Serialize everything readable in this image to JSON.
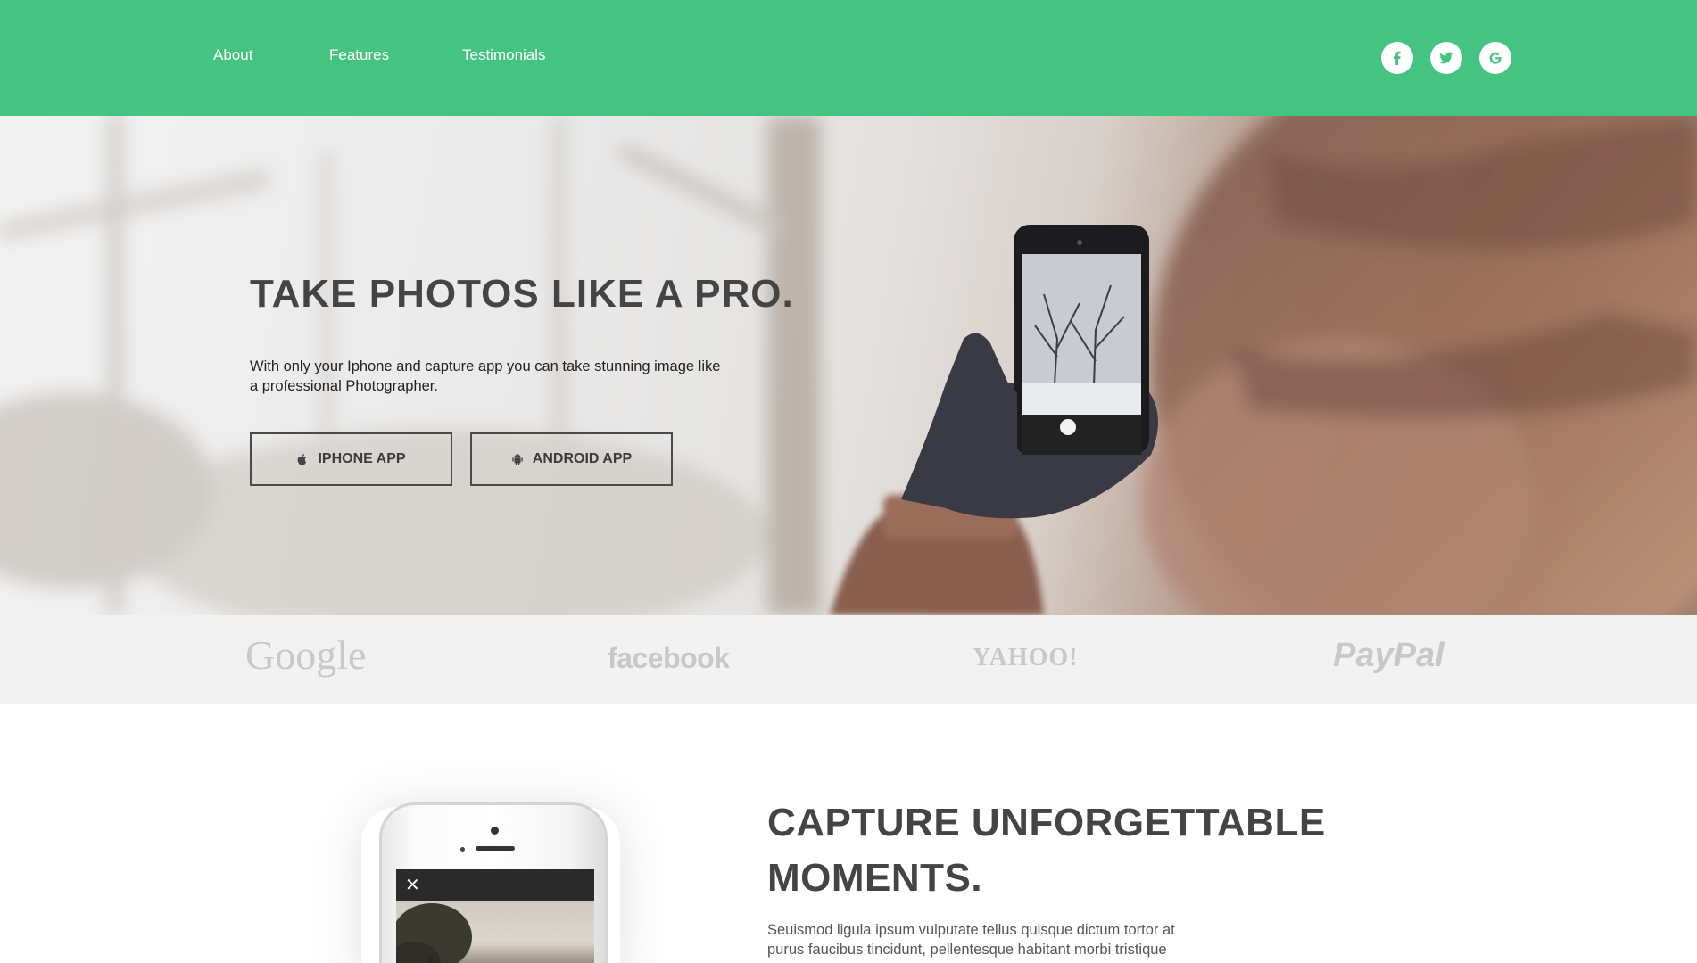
{
  "nav": {
    "links": [
      "About",
      "Features",
      "Testimonials"
    ],
    "social": [
      "facebook-icon",
      "twitter-icon",
      "google-icon"
    ]
  },
  "hero": {
    "title": "TAKE PHOTOS LIKE A PRO.",
    "text": "With only your Iphone and capture app you can take stunning image like a professional Photographer.",
    "buttons": [
      {
        "label": "IPHONE APP",
        "icon": "apple-icon"
      },
      {
        "label": "ANDROID APP",
        "icon": "android-icon"
      }
    ]
  },
  "logos": [
    "Google",
    "facebook",
    "YAHOO!",
    "PayPal"
  ],
  "feature": {
    "title": "CAPTURE UNFORGETTABLE MOMENTS.",
    "text": "Seuismod ligula ipsum vulputate tellus quisque dictum tortor at purus faucibus tincidunt, pellentesque habitant morbi tristique",
    "close_glyph": "✕"
  },
  "colors": {
    "brand_green": "#44c480",
    "logo_grey": "#c8c8c8",
    "text_dark": "#444444"
  }
}
